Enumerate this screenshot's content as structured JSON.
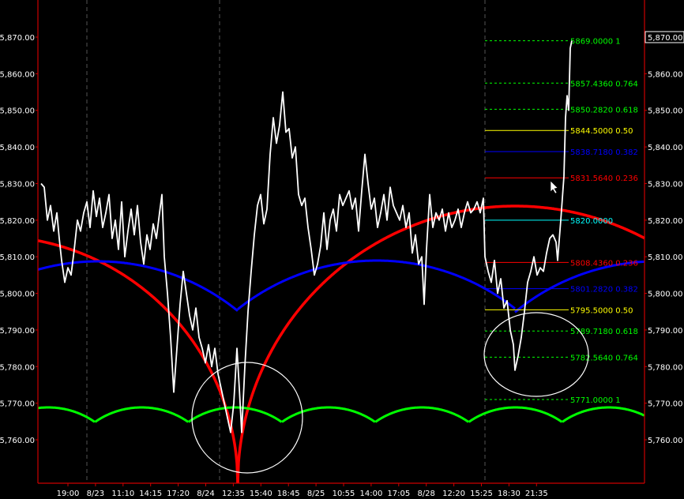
{
  "chart_data": {
    "type": "line",
    "colors": {
      "background": "#000000",
      "price": "#ffffff",
      "grid_vertical": "#555555",
      "frame": "#cc0000",
      "arc_large": "#ff0000",
      "arc_medium": "#0000ff",
      "arc_small": "#00ff00",
      "highlight_circle": "#ffffff"
    },
    "ylim": [
      5752,
      5876
    ],
    "y_ticks": [
      "5,760.00",
      "5,770.00",
      "5,780.00",
      "5,790.00",
      "5,800.00",
      "5,810.00",
      "5,820.00",
      "5,830.00",
      "5,840.00",
      "5,850.00",
      "5,860.00",
      "5,870.00"
    ],
    "y_tick_values": [
      5760,
      5770,
      5780,
      5790,
      5800,
      5810,
      5820,
      5830,
      5840,
      5850,
      5860,
      5870
    ],
    "last_price_label": "5,870.00",
    "last_price": 5870,
    "x_ticks": [
      "19:00",
      "8/23",
      "11:10",
      "14:15",
      "17:20",
      "8/24",
      "12:35",
      "15:40",
      "18:45",
      "8/25",
      "10:55",
      "14:00",
      "17:05",
      "8/28",
      "12:20",
      "15:25",
      "18:30",
      "21:35"
    ],
    "price_path": [
      [
        52,
        5830
      ],
      [
        56,
        5829
      ],
      [
        60,
        5820
      ],
      [
        64,
        5824
      ],
      [
        68,
        5817
      ],
      [
        72,
        5822
      ],
      [
        75,
        5815
      ],
      [
        78,
        5809
      ],
      [
        82,
        5803
      ],
      [
        86,
        5807
      ],
      [
        90,
        5805
      ],
      [
        94,
        5812
      ],
      [
        98,
        5820
      ],
      [
        102,
        5817
      ],
      [
        106,
        5822
      ],
      [
        110,
        5825
      ],
      [
        114,
        5818
      ],
      [
        118,
        5828
      ],
      [
        122,
        5821
      ],
      [
        126,
        5826
      ],
      [
        130,
        5818
      ],
      [
        134,
        5822
      ],
      [
        138,
        5827
      ],
      [
        142,
        5815
      ],
      [
        146,
        5820
      ],
      [
        150,
        5812
      ],
      [
        154,
        5825
      ],
      [
        158,
        5810
      ],
      [
        162,
        5817
      ],
      [
        166,
        5823
      ],
      [
        170,
        5816
      ],
      [
        174,
        5824
      ],
      [
        178,
        5814
      ],
      [
        182,
        5808
      ],
      [
        186,
        5816
      ],
      [
        190,
        5812
      ],
      [
        194,
        5819
      ],
      [
        198,
        5815
      ],
      [
        202,
        5822
      ],
      [
        205,
        5827
      ],
      [
        208,
        5810
      ],
      [
        212,
        5800
      ],
      [
        216,
        5788
      ],
      [
        220,
        5773
      ],
      [
        224,
        5785
      ],
      [
        228,
        5797
      ],
      [
        232,
        5806
      ],
      [
        236,
        5800
      ],
      [
        240,
        5794
      ],
      [
        244,
        5790
      ],
      [
        248,
        5796
      ],
      [
        252,
        5788
      ],
      [
        256,
        5785
      ],
      [
        260,
        5781
      ],
      [
        264,
        5786
      ],
      [
        268,
        5780
      ],
      [
        272,
        5785
      ],
      [
        276,
        5778
      ],
      [
        280,
        5774
      ],
      [
        284,
        5770
      ],
      [
        288,
        5766
      ],
      [
        292,
        5762
      ],
      [
        296,
        5770
      ],
      [
        300,
        5785
      ],
      [
        303,
        5774
      ],
      [
        306,
        5762
      ],
      [
        310,
        5780
      ],
      [
        314,
        5795
      ],
      [
        318,
        5806
      ],
      [
        322,
        5816
      ],
      [
        326,
        5824
      ],
      [
        330,
        5827
      ],
      [
        334,
        5819
      ],
      [
        338,
        5823
      ],
      [
        342,
        5838
      ],
      [
        346,
        5848
      ],
      [
        350,
        5841
      ],
      [
        354,
        5846
      ],
      [
        358,
        5855
      ],
      [
        362,
        5844
      ],
      [
        366,
        5845
      ],
      [
        370,
        5837
      ],
      [
        374,
        5840
      ],
      [
        378,
        5827
      ],
      [
        382,
        5824
      ],
      [
        386,
        5826
      ],
      [
        390,
        5818
      ],
      [
        394,
        5812
      ],
      [
        398,
        5805
      ],
      [
        402,
        5808
      ],
      [
        406,
        5813
      ],
      [
        410,
        5822
      ],
      [
        414,
        5812
      ],
      [
        418,
        5820
      ],
      [
        422,
        5823
      ],
      [
        426,
        5817
      ],
      [
        430,
        5827
      ],
      [
        434,
        5824
      ],
      [
        438,
        5826
      ],
      [
        442,
        5828
      ],
      [
        446,
        5823
      ],
      [
        450,
        5826
      ],
      [
        454,
        5817
      ],
      [
        458,
        5828
      ],
      [
        462,
        5838
      ],
      [
        466,
        5830
      ],
      [
        470,
        5823
      ],
      [
        474,
        5826
      ],
      [
        478,
        5818
      ],
      [
        482,
        5822
      ],
      [
        486,
        5827
      ],
      [
        490,
        5820
      ],
      [
        494,
        5829
      ],
      [
        498,
        5824
      ],
      [
        502,
        5822
      ],
      [
        506,
        5820
      ],
      [
        510,
        5824
      ],
      [
        514,
        5818
      ],
      [
        518,
        5822
      ],
      [
        522,
        5811
      ],
      [
        526,
        5816
      ],
      [
        530,
        5808
      ],
      [
        534,
        5810
      ],
      [
        537,
        5797
      ],
      [
        540,
        5812
      ],
      [
        544,
        5827
      ],
      [
        548,
        5818
      ],
      [
        552,
        5822
      ],
      [
        556,
        5820
      ],
      [
        560,
        5823
      ],
      [
        564,
        5817
      ],
      [
        568,
        5822
      ],
      [
        572,
        5818
      ],
      [
        576,
        5820
      ],
      [
        580,
        5823
      ],
      [
        584,
        5818
      ],
      [
        588,
        5822
      ],
      [
        592,
        5825
      ],
      [
        596,
        5822
      ],
      [
        600,
        5823
      ],
      [
        604,
        5825
      ],
      [
        608,
        5822
      ],
      [
        612,
        5826
      ],
      [
        614,
        5810
      ],
      [
        618,
        5806
      ],
      [
        622,
        5803
      ],
      [
        626,
        5809
      ],
      [
        630,
        5800
      ],
      [
        634,
        5804
      ],
      [
        638,
        5796
      ],
      [
        642,
        5798
      ],
      [
        646,
        5790
      ],
      [
        650,
        5786
      ],
      [
        652,
        5779
      ],
      [
        656,
        5783
      ],
      [
        660,
        5788
      ],
      [
        664,
        5795
      ],
      [
        668,
        5803
      ],
      [
        672,
        5806
      ],
      [
        676,
        5810
      ],
      [
        680,
        5805
      ],
      [
        684,
        5807
      ],
      [
        688,
        5806
      ],
      [
        692,
        5811
      ],
      [
        696,
        5815
      ],
      [
        700,
        5816
      ],
      [
        704,
        5814
      ],
      [
        706,
        5809
      ],
      [
        710,
        5820
      ],
      [
        714,
        5832
      ],
      [
        716,
        5848
      ],
      [
        718,
        5854
      ],
      [
        720,
        5850
      ],
      [
        722,
        5867
      ],
      [
        724,
        5869
      ]
    ],
    "fib_levels": [
      {
        "value": 5869.0,
        "label": "5869.0000 1",
        "color": "#00ff00",
        "dashed": true
      },
      {
        "value": 5857.436,
        "label": "5857.4360 0.764",
        "color": "#00ff00",
        "dashed": true
      },
      {
        "value": 5850.282,
        "label": "5850.2820 0.618",
        "color": "#00ff00",
        "dashed": true
      },
      {
        "value": 5844.5,
        "label": "5844.5000 0.50",
        "color": "#ffff00",
        "dashed": false
      },
      {
        "value": 5838.718,
        "label": "5838.7180 0.382",
        "color": "#0000ff",
        "dashed": false
      },
      {
        "value": 5831.564,
        "label": "5831.5640 0.236",
        "color": "#ff0000",
        "dashed": false
      },
      {
        "value": 5820.0,
        "label": "5820.0000",
        "color": "#00ffff",
        "dashed": false
      },
      {
        "value": 5808.436,
        "label": "5808.4360 0.236",
        "color": "#ff0000",
        "dashed": false
      },
      {
        "value": 5801.282,
        "label": "5801.2820 0.382",
        "color": "#0000ff",
        "dashed": false
      },
      {
        "value": 5795.5,
        "label": "5795.5000 0.50",
        "color": "#ffff00",
        "dashed": false
      },
      {
        "value": 5789.718,
        "label": "5789.7180 0.618",
        "color": "#00ff00",
        "dashed": true
      },
      {
        "value": 5782.564,
        "label": "5782.5640 0.764",
        "color": "#00ff00",
        "dashed": true
      },
      {
        "value": 5771.0,
        "label": "5771.0000 1",
        "color": "#00ff00",
        "dashed": true
      }
    ]
  }
}
